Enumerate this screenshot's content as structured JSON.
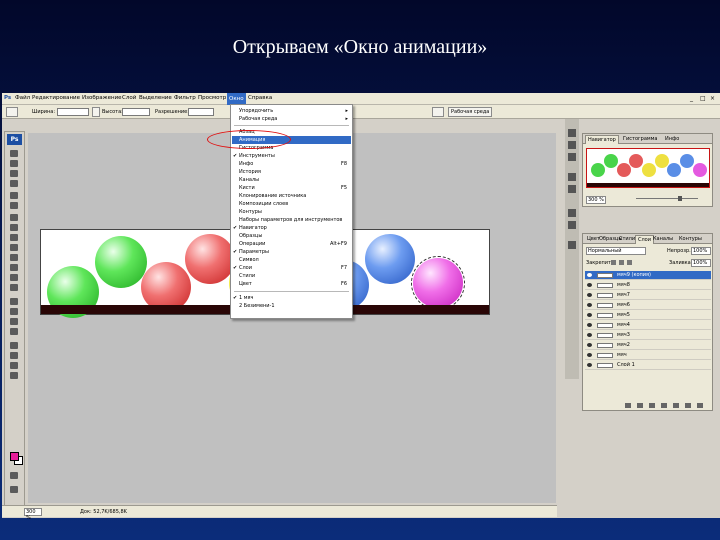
{
  "slide": {
    "title": "Открываем «Окно анимации»"
  },
  "menubar": {
    "items": [
      "Файл",
      "Редактирование",
      "Изображение",
      "Слой",
      "Выделение",
      "Фильтр",
      "Просмотр",
      "Окно",
      "Справка"
    ],
    "active": "Окно",
    "window_controls": [
      "_",
      "□",
      "×"
    ]
  },
  "options": {
    "width_label": "Ширина:",
    "height_label": "Высота:",
    "resolution_label": "Разрешение:",
    "workspace_button": "Рабочая среда"
  },
  "window_menu": {
    "items": [
      {
        "label": "Упорядочить",
        "submenu": true
      },
      {
        "label": "Рабочая среда",
        "submenu": true
      },
      {
        "separator": true
      },
      {
        "label": "Абзац"
      },
      {
        "label": "Анимация",
        "highlighted": true
      },
      {
        "label": "Гистограмма"
      },
      {
        "label": "Инструменты",
        "checked": true
      },
      {
        "label": "Инфо",
        "shortcut": "F8"
      },
      {
        "label": "История"
      },
      {
        "label": "Каналы"
      },
      {
        "label": "Кисти",
        "shortcut": "F5"
      },
      {
        "label": "Клонирование источника"
      },
      {
        "label": "Композиции слоев"
      },
      {
        "label": "Контуры"
      },
      {
        "label": "Наборы параметров для инструментов"
      },
      {
        "label": "Навигатор",
        "checked": true
      },
      {
        "label": "Образцы"
      },
      {
        "label": "Операции",
        "shortcut": "Alt+F9"
      },
      {
        "label": "Параметры",
        "checked": true
      },
      {
        "label": "Символ"
      },
      {
        "label": "Слои",
        "checked": true,
        "shortcut": "F7"
      },
      {
        "label": "Стили"
      },
      {
        "label": "Цвет",
        "shortcut": "F6"
      },
      {
        "separator": true
      },
      {
        "label": "1 мяч",
        "checked": true
      },
      {
        "label": "2 Безимени-1"
      }
    ]
  },
  "navigator_panel": {
    "tabs": [
      "Навигатор",
      "Гистограмма",
      "Инфо"
    ],
    "zoom": "300 %"
  },
  "layers_panel": {
    "tabs": [
      "Цвет",
      "Образцы",
      "Стили",
      "Слои",
      "Каналы",
      "Контуры"
    ],
    "blend_mode": "Нормальный",
    "opacity_label": "Непрозр.:",
    "opacity_value": "100%",
    "lock_label": "Закрепить:",
    "fill_label": "Заливка:",
    "fill_value": "100%",
    "layers": [
      {
        "name": "мяч9 (копия)",
        "selected": true
      },
      {
        "name": "мяч8"
      },
      {
        "name": "мяч7"
      },
      {
        "name": "мяч6"
      },
      {
        "name": "мяч5"
      },
      {
        "name": "мяч4"
      },
      {
        "name": "мяч3"
      },
      {
        "name": "мяч2"
      },
      {
        "name": "мяч"
      },
      {
        "name": "Слой 1"
      }
    ]
  },
  "status": {
    "zoom": "300 %",
    "doc_info": "Док: 52,7K/685,8K"
  },
  "colors": {
    "foreground": "#e61e98",
    "background": "#ffffff",
    "highlight": "#316ac5",
    "annotation": "#e01010"
  },
  "balls": [
    "green",
    "green",
    "red",
    "red",
    "yellow",
    "yellow",
    "blue",
    "blue",
    "magenta"
  ]
}
